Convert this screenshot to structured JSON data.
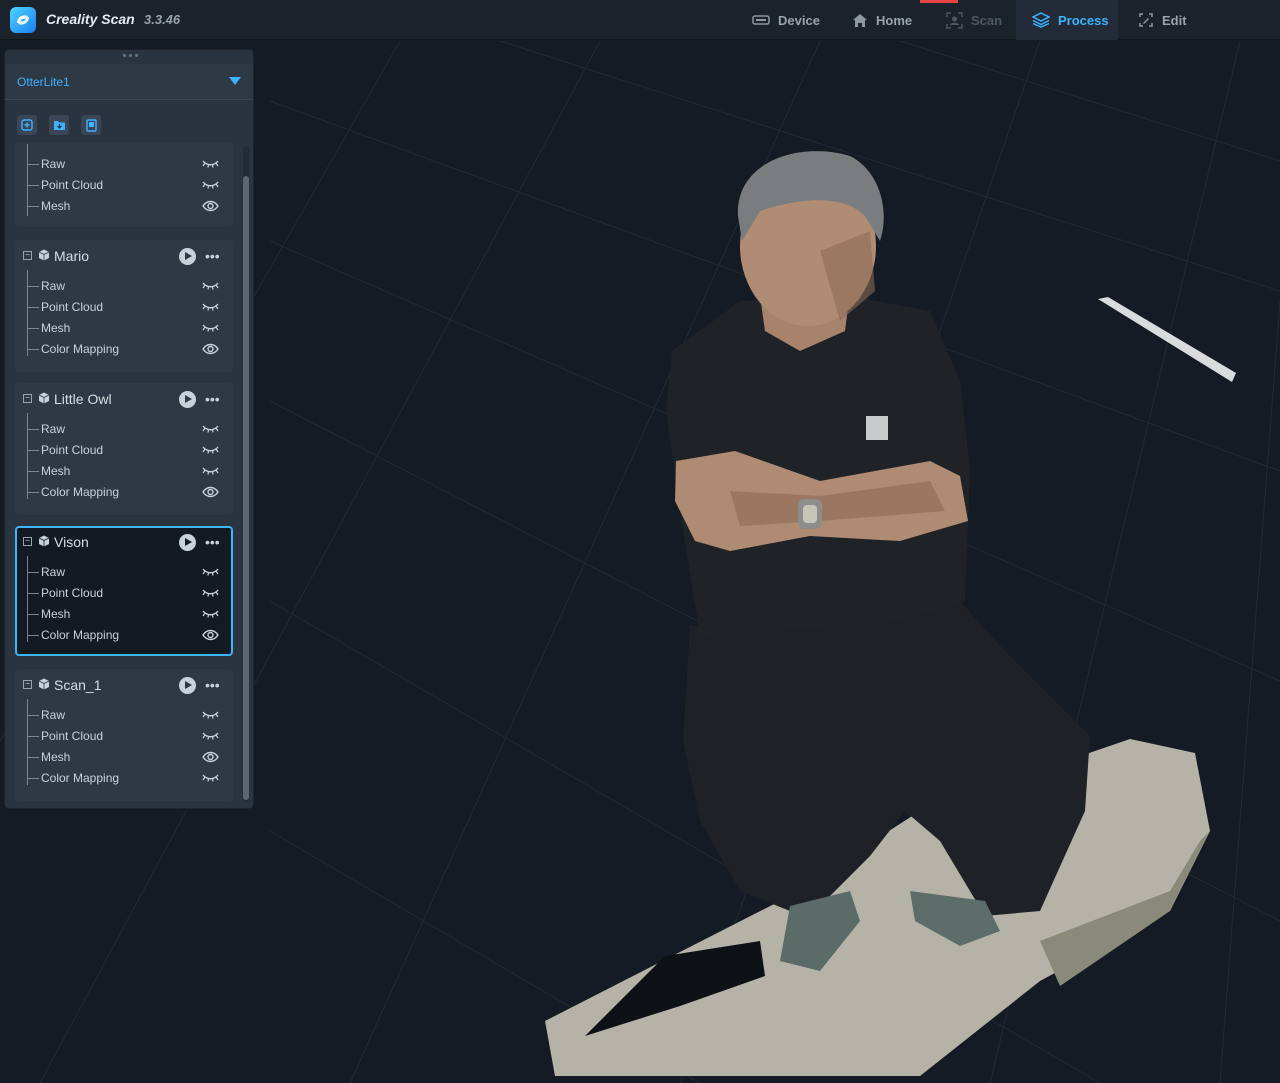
{
  "app": {
    "title": "Creality Scan",
    "version": "3.3.46"
  },
  "nav": {
    "items": [
      {
        "label": "Device",
        "icon": "device-icon",
        "state": "normal"
      },
      {
        "label": "Home",
        "icon": "home-icon",
        "state": "normal"
      },
      {
        "label": "Scan",
        "icon": "scan-icon",
        "state": "disabled"
      },
      {
        "label": "Process",
        "icon": "layers-icon",
        "state": "active"
      },
      {
        "label": "Edit",
        "icon": "edit-icon",
        "state": "normal"
      }
    ]
  },
  "panel": {
    "device": "OtterLite1",
    "toolbar": [
      "add-project-icon",
      "open-folder-icon",
      "file-icon"
    ],
    "projects": [
      {
        "name": "",
        "partial": true,
        "selected": false,
        "layers": [
          {
            "label": "Raw",
            "visible": false
          },
          {
            "label": "Point Cloud",
            "visible": false
          },
          {
            "label": "Mesh",
            "visible": true
          }
        ]
      },
      {
        "name": "Mario",
        "selected": false,
        "layers": [
          {
            "label": "Raw",
            "visible": false
          },
          {
            "label": "Point Cloud",
            "visible": false
          },
          {
            "label": "Mesh",
            "visible": false
          },
          {
            "label": "Color Mapping",
            "visible": true
          }
        ]
      },
      {
        "name": "Little Owl",
        "selected": false,
        "layers": [
          {
            "label": "Raw",
            "visible": false
          },
          {
            "label": "Point Cloud",
            "visible": false
          },
          {
            "label": "Mesh",
            "visible": false
          },
          {
            "label": "Color Mapping",
            "visible": true
          }
        ]
      },
      {
        "name": "Vison",
        "selected": true,
        "layers": [
          {
            "label": "Raw",
            "visible": false
          },
          {
            "label": "Point Cloud",
            "visible": false
          },
          {
            "label": "Mesh",
            "visible": false
          },
          {
            "label": "Color Mapping",
            "visible": true
          }
        ]
      },
      {
        "name": "Scan_1",
        "selected": false,
        "layers": [
          {
            "label": "Raw",
            "visible": false
          },
          {
            "label": "Point Cloud",
            "visible": false
          },
          {
            "label": "Mesh",
            "visible": true
          },
          {
            "label": "Color Mapping",
            "visible": false
          }
        ]
      }
    ]
  },
  "colors": {
    "accent": "#3cb4ff",
    "background": "#151b24",
    "panel": "#2a3340"
  }
}
